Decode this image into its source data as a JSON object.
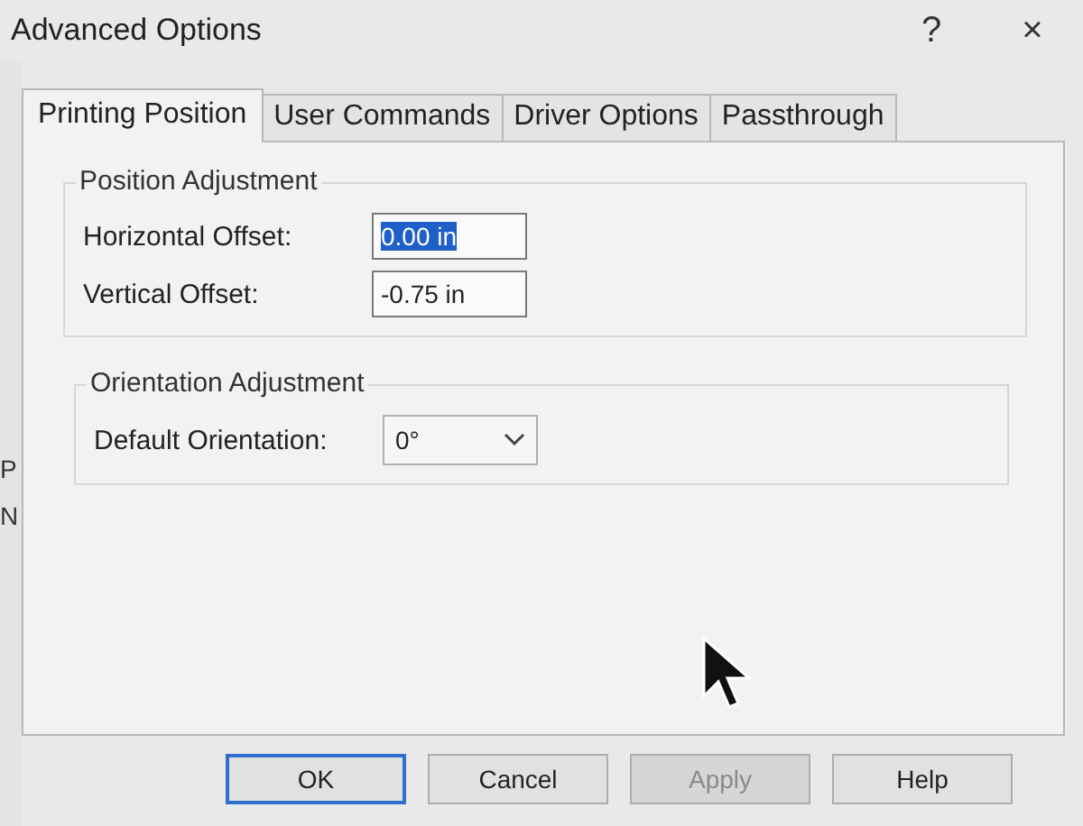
{
  "window": {
    "title": "Advanced Options",
    "help": "?",
    "close": "×"
  },
  "background_window": {
    "texts": [
      "P",
      "N"
    ]
  },
  "tabs": [
    {
      "label": "Printing Position",
      "selected": true
    },
    {
      "label": "User Commands",
      "selected": false
    },
    {
      "label": "Driver Options",
      "selected": false
    },
    {
      "label": "Passthrough",
      "selected": false
    }
  ],
  "position_adjustment": {
    "title": "Position Adjustment",
    "fields": [
      {
        "label": "Horizontal Offset:",
        "value": "0.00 in",
        "selected": true
      },
      {
        "label": "Vertical Offset:",
        "value": "-0.75 in",
        "selected": false
      }
    ]
  },
  "orientation_adjustment": {
    "title": "Orientation Adjustment",
    "label": "Default Orientation:",
    "value": "0°"
  },
  "buttons": [
    {
      "label": "OK",
      "default": true,
      "disabled": false
    },
    {
      "label": "Cancel",
      "default": false,
      "disabled": false
    },
    {
      "label": "Apply",
      "default": false,
      "disabled": true
    },
    {
      "label": "Help",
      "default": false,
      "disabled": false
    }
  ]
}
